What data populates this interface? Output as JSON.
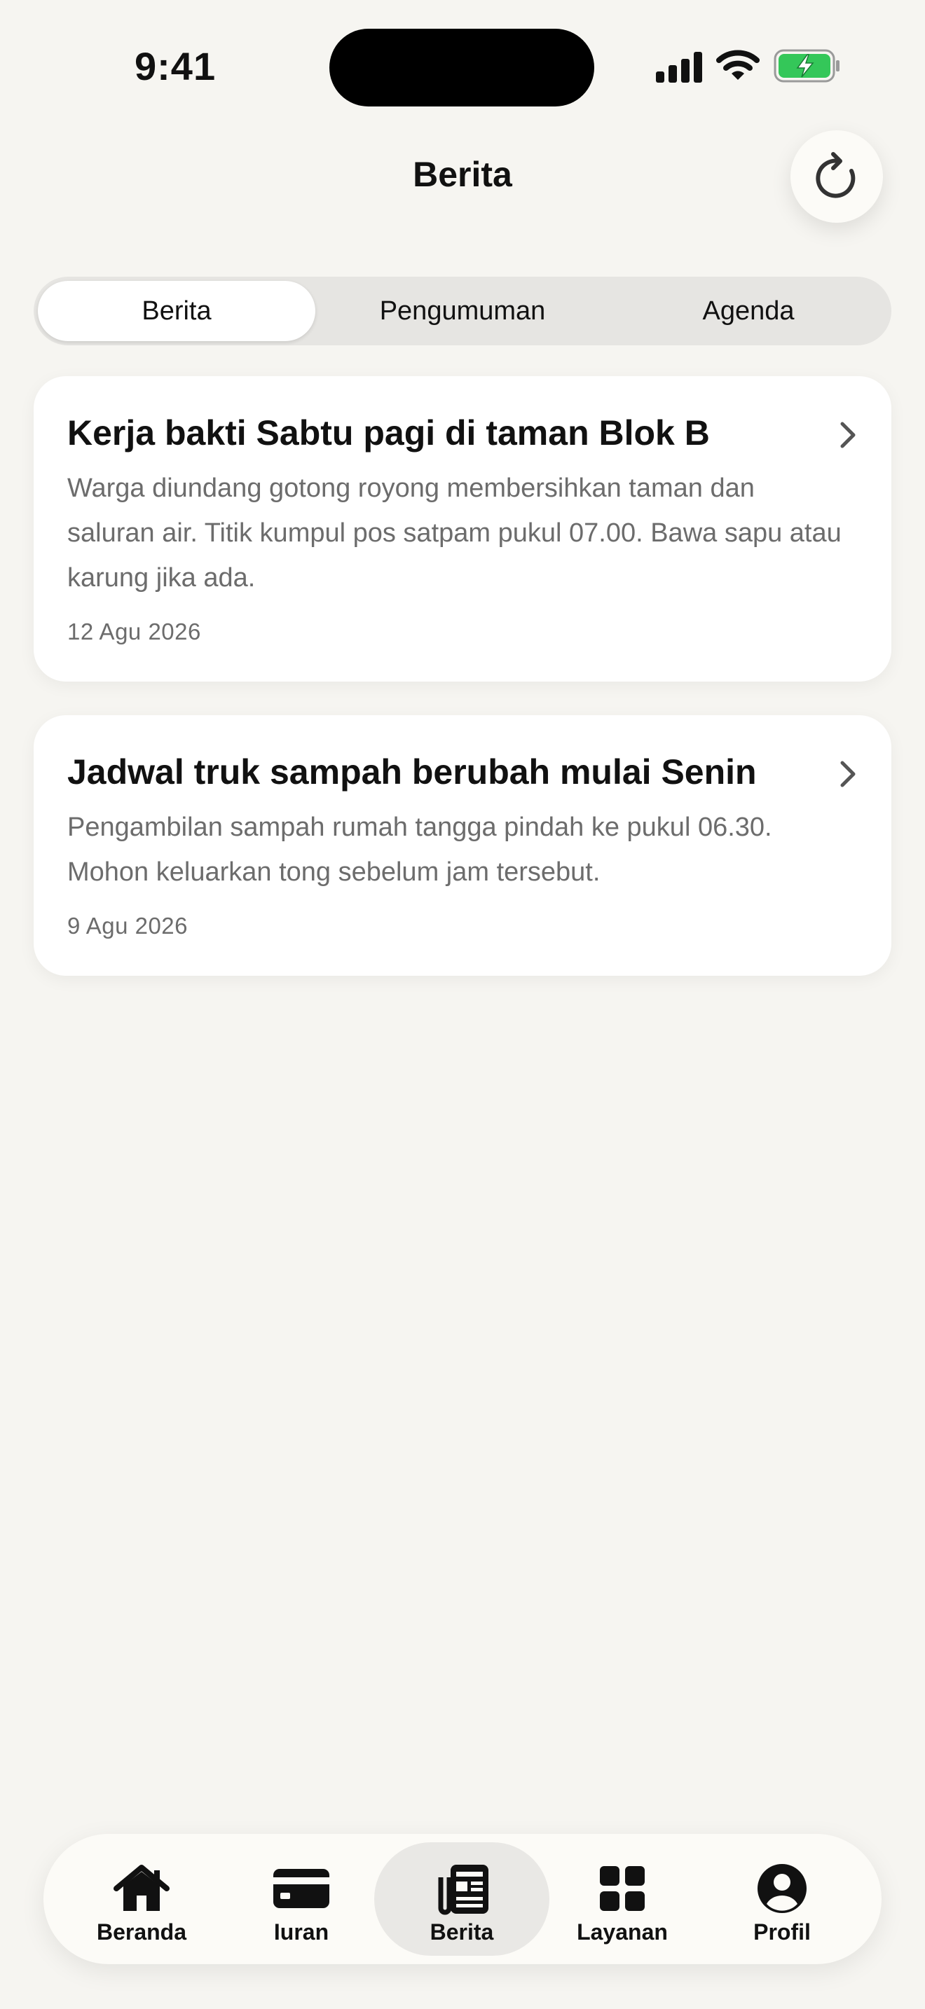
{
  "status_bar": {
    "time": "9:41"
  },
  "header": {
    "title": "Berita"
  },
  "segments": [
    {
      "label": "Berita",
      "active": true
    },
    {
      "label": "Pengumuman",
      "active": false
    },
    {
      "label": "Agenda",
      "active": false
    }
  ],
  "news": [
    {
      "title": "Kerja bakti Sabtu pagi di taman Blok B",
      "body": "Warga diundang gotong royong membersihkan taman dan saluran air. Titik kumpul pos satpam pukul 07.00. Bawa sapu atau karung jika ada.",
      "date": "12 Agu 2026"
    },
    {
      "title": "Jadwal truk sampah berubah mulai Senin",
      "body": "Pengambilan sampah rumah tangga pindah ke pukul 06.30. Mohon keluarkan tong sebelum jam tersebut.",
      "date": "9 Agu 2026"
    }
  ],
  "tab_bar": [
    {
      "label": "Beranda",
      "icon": "home-icon",
      "active": false
    },
    {
      "label": "Iuran",
      "icon": "card-icon",
      "active": false
    },
    {
      "label": "Berita",
      "icon": "newspaper-icon",
      "active": true
    },
    {
      "label": "Layanan",
      "icon": "grid-icon",
      "active": false
    },
    {
      "label": "Profil",
      "icon": "profile-icon",
      "active": false
    }
  ],
  "colors": {
    "background": "#f6f5f1",
    "card": "#ffffff",
    "battery_green": "#34c759",
    "muted_text": "#6c6c6c"
  }
}
